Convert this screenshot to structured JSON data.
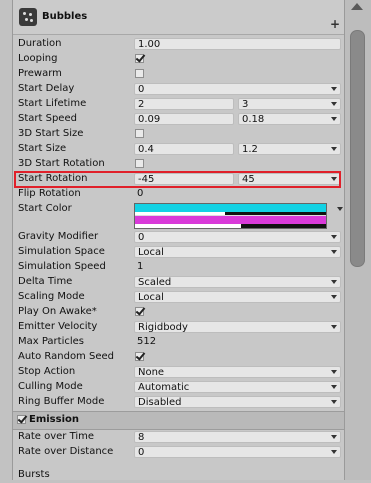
{
  "header": {
    "title": "Bubbles"
  },
  "rows": {
    "duration": {
      "label": "Duration",
      "value": "1.00"
    },
    "looping": {
      "label": "Looping",
      "checked": true
    },
    "prewarm": {
      "label": "Prewarm",
      "checked": false
    },
    "start_delay": {
      "label": "Start Delay",
      "value": "0"
    },
    "start_lifetime": {
      "label": "Start Lifetime",
      "min": "2",
      "max": "3"
    },
    "start_speed": {
      "label": "Start Speed",
      "min": "0.09",
      "max": "0.18"
    },
    "start_size_3d": {
      "label": "3D Start Size",
      "checked": false
    },
    "start_size": {
      "label": "Start Size",
      "min": "0.4",
      "max": "1.2"
    },
    "start_rotation_3d": {
      "label": "3D Start Rotation",
      "checked": false
    },
    "start_rotation": {
      "label": "Start Rotation",
      "min": "-45",
      "max": "45"
    },
    "flip_rotation": {
      "label": "Flip Rotation",
      "value": "0"
    },
    "start_color": {
      "label": "Start Color",
      "color_top": "#12d2e4",
      "color_bottom": "#d93ad9"
    },
    "gravity_modifier": {
      "label": "Gravity Modifier",
      "value": "0"
    },
    "simulation_space": {
      "label": "Simulation Space",
      "value": "Local"
    },
    "simulation_speed": {
      "label": "Simulation Speed",
      "value": "1"
    },
    "delta_time": {
      "label": "Delta Time",
      "value": "Scaled"
    },
    "scaling_mode": {
      "label": "Scaling Mode",
      "value": "Local"
    },
    "play_on_awake": {
      "label": "Play On Awake*",
      "checked": true
    },
    "emitter_velocity": {
      "label": "Emitter Velocity",
      "value": "Rigidbody"
    },
    "max_particles": {
      "label": "Max Particles",
      "value": "512"
    },
    "auto_random_seed": {
      "label": "Auto Random Seed",
      "checked": true
    },
    "stop_action": {
      "label": "Stop Action",
      "value": "None"
    },
    "culling_mode": {
      "label": "Culling Mode",
      "value": "Automatic"
    },
    "ring_buffer_mode": {
      "label": "Ring Buffer Mode",
      "value": "Disabled"
    }
  },
  "emission": {
    "label": "Emission",
    "enabled": true,
    "rate_over_time": {
      "label": "Rate over Time",
      "value": "8"
    },
    "rate_over_distance": {
      "label": "Rate over Distance",
      "value": "0"
    },
    "bursts_label": "Bursts"
  },
  "colors": {
    "highlight": "#e0202a"
  }
}
